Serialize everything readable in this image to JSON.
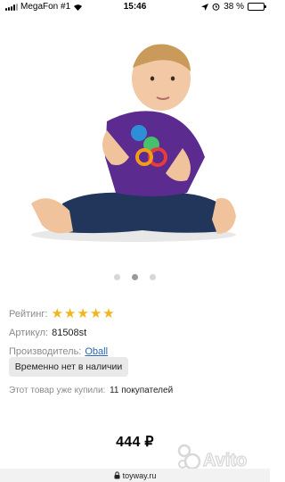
{
  "status_bar": {
    "carrier": "MegaFon #1",
    "time": "15:46",
    "battery": "38 %",
    "battery_level": 0.38
  },
  "carousel": {
    "page_count": 3,
    "active_index": 1
  },
  "product": {
    "rating_label": "Рейтинг:",
    "rating_stars": 5,
    "article_label": "Артикул:",
    "article_value": "81508st",
    "maker_label": "Производитель:",
    "maker_value": "Oball",
    "stock_button": "Временно нет в наличии",
    "bought_label": "Этот товар уже купили:",
    "bought_value": "11 покупателей",
    "price": "444 ₽"
  },
  "browser": {
    "domain": "toyway.ru"
  },
  "watermark": {
    "text": "Avito"
  },
  "colors": {
    "accent_link": "#2a63b7",
    "star": "#f2b51c",
    "button_bg": "#e9e9e9"
  }
}
